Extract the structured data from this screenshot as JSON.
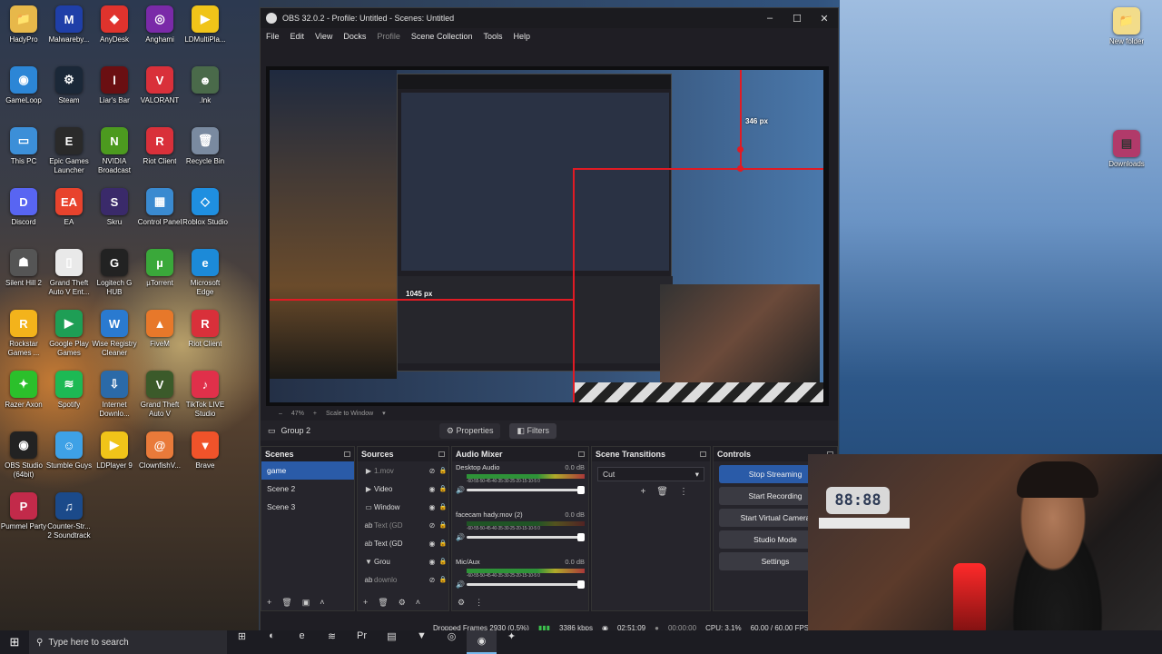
{
  "desktop": {
    "icons": [
      {
        "label": "HadyPro",
        "glyph": "📁",
        "color": "#e7b84a"
      },
      {
        "label": "Malwareby...",
        "glyph": "M",
        "color": "#1f3fa8"
      },
      {
        "label": "AnyDesk",
        "glyph": "◆",
        "color": "#e0332d"
      },
      {
        "label": "Anghami",
        "glyph": "◎",
        "color": "#7a2aa8"
      },
      {
        "label": "LDMultiPla...",
        "glyph": "▶",
        "color": "#f0c419"
      },
      {
        "label": "GameLoop",
        "glyph": "◉",
        "color": "#2c86d6"
      },
      {
        "label": "Steam",
        "glyph": "⚙",
        "color": "#1b2838"
      },
      {
        "label": "Liar's Bar",
        "glyph": "l",
        "color": "#6a0f12"
      },
      {
        "label": "VALORANT",
        "glyph": "V",
        "color": "#d9303a"
      },
      {
        "label": ".lnk",
        "glyph": "☻",
        "color": "#4a6a4a"
      },
      {
        "label": "This PC",
        "glyph": "▭",
        "color": "#3c8fd8"
      },
      {
        "label": "Epic Games Launcher",
        "glyph": "E",
        "color": "#2a2a2a"
      },
      {
        "label": "NVIDIA Broadcast",
        "glyph": "N",
        "color": "#4c9a1f"
      },
      {
        "label": "Riot Client",
        "glyph": "R",
        "color": "#d9303a"
      },
      {
        "label": "Recycle Bin",
        "glyph": "🗑",
        "color": "#7a8aa0"
      },
      {
        "label": "Discord",
        "glyph": "D",
        "color": "#5865f2"
      },
      {
        "label": "EA",
        "glyph": "EA",
        "color": "#e8432d"
      },
      {
        "label": "Skru",
        "glyph": "S",
        "color": "#3a2a6a"
      },
      {
        "label": "Control Panel",
        "glyph": "▦",
        "color": "#3a8ad0"
      },
      {
        "label": "Roblox Studio",
        "glyph": "◇",
        "color": "#1f8fe0"
      },
      {
        "label": "Silent Hill 2",
        "glyph": "☗",
        "color": "#555"
      },
      {
        "label": "Grand Theft Auto V Ent...",
        "glyph": "▯",
        "color": "#e9e9e9"
      },
      {
        "label": "Logitech G HUB",
        "glyph": "G",
        "color": "#222"
      },
      {
        "label": "µTorrent",
        "glyph": "µ",
        "color": "#3aa83a"
      },
      {
        "label": "Microsoft Edge",
        "glyph": "e",
        "color": "#1c8ad8"
      },
      {
        "label": "Rockstar Games ...",
        "glyph": "R",
        "color": "#f3b31b"
      },
      {
        "label": "Google Play Games",
        "glyph": "▶",
        "color": "#1e9e55"
      },
      {
        "label": "Wise Registry Cleaner",
        "glyph": "W",
        "color": "#2a7ad0"
      },
      {
        "label": "FiveM",
        "glyph": "▲",
        "color": "#e7782a"
      },
      {
        "label": "Riot Client",
        "glyph": "R",
        "color": "#d9303a"
      },
      {
        "label": "Razer Axon",
        "glyph": "✦",
        "color": "#2bc02b"
      },
      {
        "label": "Spotify",
        "glyph": "≋",
        "color": "#1db954"
      },
      {
        "label": "Internet Downlo...",
        "glyph": "⇩",
        "color": "#2b6aa8"
      },
      {
        "label": "Grand Theft Auto V",
        "glyph": "V",
        "color": "#3b5a2a"
      },
      {
        "label": "TikTok LIVE Studio",
        "glyph": "♪",
        "color": "#e0304a"
      },
      {
        "label": "OBS Studio (64bit)",
        "glyph": "◉",
        "color": "#222"
      },
      {
        "label": "Stumble Guys",
        "glyph": "☺",
        "color": "#3ea1e6"
      },
      {
        "label": "LDPlayer 9",
        "glyph": "▶",
        "color": "#f0c419"
      },
      {
        "label": "ClownfishV...",
        "glyph": "@",
        "color": "#e97a3a"
      },
      {
        "label": "Brave",
        "glyph": "▼",
        "color": "#f0532a"
      },
      {
        "label": "Pummel Party",
        "glyph": "P",
        "color": "#c22a4a"
      },
      {
        "label": "Counter-Str... 2 Soundtrack",
        "glyph": "♫",
        "color": "#1b4a8a"
      }
    ],
    "right_icons": [
      {
        "label": "New folder",
        "glyph": "📁"
      },
      {
        "label": "Downloads",
        "glyph": "▤"
      }
    ]
  },
  "obs": {
    "title": "OBS 32.0.2 - Profile: Untitled - Scenes: Untitled",
    "menu": [
      "File",
      "Edit",
      "View",
      "Docks",
      "Profile",
      "Scene Collection",
      "Tools",
      "Help"
    ],
    "preview": {
      "measure_top": "346 px",
      "measure_left": "1045 px"
    },
    "zoom": {
      "level": "47%",
      "mode": "Scale to Window"
    },
    "source_toolbar": {
      "group": "Group 2",
      "properties": "Properties",
      "filters": "Filters"
    },
    "scenes": {
      "title": "Scenes",
      "items": [
        "game",
        "Scene 2",
        "Scene 3"
      ],
      "selected": "game"
    },
    "sources": {
      "title": "Sources",
      "items": [
        {
          "name": "1.mov",
          "icon": "▶",
          "dim": true
        },
        {
          "name": "Video",
          "icon": "▶",
          "dim": false
        },
        {
          "name": "Window",
          "icon": "▭",
          "dim": false
        },
        {
          "name": "Text (GD",
          "icon": "ab",
          "dim": true
        },
        {
          "name": "Text (GD",
          "icon": "ab",
          "dim": false
        },
        {
          "name": "Grou",
          "icon": "▼",
          "dim": false
        },
        {
          "name": "downlo",
          "icon": "ab",
          "dim": true
        }
      ]
    },
    "audio_mixer": {
      "title": "Audio Mixer",
      "ticks": "-60-55-50-45-40-35-30-25-20-15-10-5 0",
      "channels": [
        {
          "name": "Desktop Audio",
          "db": "0.0 dB",
          "level": 0.9
        },
        {
          "name": "facecam hady.mov (2)",
          "db": "0.0 dB",
          "level": 0.3
        },
        {
          "name": "Mic/Aux",
          "db": "0.0 dB",
          "level": 0.9
        }
      ]
    },
    "scene_transitions": {
      "title": "Scene Transitions",
      "selected": "Cut"
    },
    "controls": {
      "title": "Controls",
      "buttons": [
        "Stop Streaming",
        "Start Recording",
        "Start Virtual Camera",
        "Studio Mode",
        "Settings"
      ]
    },
    "status": {
      "dropped": "Dropped Frames 2930 (0.5%)",
      "bitrate": "3386 kbps",
      "stream_time": "02:51:09",
      "rec_time": "00:00:00",
      "cpu": "CPU: 3.1%",
      "fps": "60.00 / 60.00 FPS"
    }
  },
  "webcam": {
    "clock": "88:88"
  },
  "taskbar": {
    "search_placeholder": "Type here to search",
    "pinned": [
      "⊞",
      "◐",
      "e",
      "≋",
      "Pr",
      "▤",
      "▼",
      "◎",
      "◉",
      "✦"
    ]
  }
}
